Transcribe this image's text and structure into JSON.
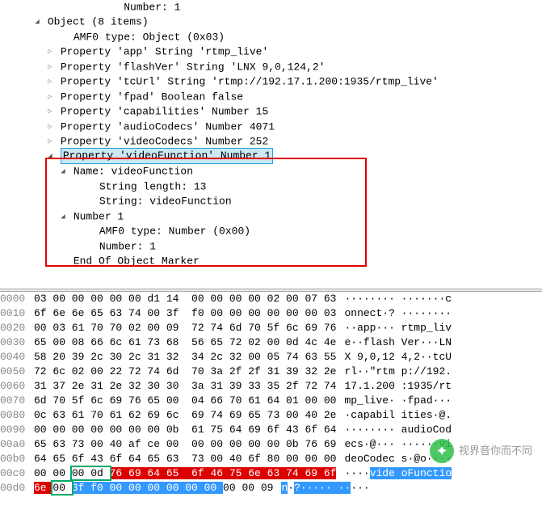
{
  "tree": {
    "n0": "        Number: 1",
    "n1": "Object (8 items)",
    "n2": "AMF0 type: Object (0x03)",
    "n3": "Property 'app' String 'rtmp_live'",
    "n4": "Property 'flashVer' String 'LNX 9,0,124,2'",
    "n5": "Property 'tcUrl' String 'rtmp://192.17.1.200:1935/rtmp_live'",
    "n6": "Property 'fpad' Boolean false",
    "n7": "Property 'capabilities' Number 15",
    "n8": "Property 'audioCodecs' Number 4071",
    "n9": "Property 'videoCodecs' Number 252",
    "n10": "Property 'videoFunction' Number 1",
    "n11": "Name: videoFunction",
    "n12": "String length: 13",
    "n13": "String: videoFunction",
    "n14": "Number 1",
    "n15": "AMF0 type: Number (0x00)",
    "n16": "Number: 1",
    "n17": "End Of Object Marker"
  },
  "hex": {
    "r0000": {
      "off": "0000",
      "b": "03 00 00 00 00 00 d1 14  00 00 00 00 02 00 07 63",
      "a": "········ ·······c"
    },
    "r0010": {
      "off": "0010",
      "b": "6f 6e 6e 65 63 74 00 3f  f0 00 00 00 00 00 00 03",
      "a": "onnect·? ········"
    },
    "r0020": {
      "off": "0020",
      "b": "00 03 61 70 70 02 00 09  72 74 6d 70 5f 6c 69 76",
      "a": "··app··· rtmp_liv"
    },
    "r0030": {
      "off": "0030",
      "b": "65 00 08 66 6c 61 73 68  56 65 72 02 00 0d 4c 4e",
      "a": "e··flash Ver···LN"
    },
    "r0040": {
      "off": "0040",
      "b": "58 20 39 2c 30 2c 31 32  34 2c 32 00 05 74 63 55",
      "a": "X 9,0,12 4,2··tcU"
    },
    "r0050": {
      "off": "0050",
      "b": "72 6c 02 00 22 72 74 6d  70 3a 2f 2f 31 39 32 2e",
      "a": "rl··\"rtm p://192."
    },
    "r0060": {
      "off": "0060",
      "b": "31 37 2e 31 2e 32 30 30  3a 31 39 33 35 2f 72 74",
      "a": "17.1.200 :1935/rt"
    },
    "r0070": {
      "off": "0070",
      "b": "6d 70 5f 6c 69 76 65 00  04 66 70 61 64 01 00 00",
      "a": "mp_live· ·fpad···"
    },
    "r0080": {
      "off": "0080",
      "b": "0c 63 61 70 61 62 69 6c  69 74 69 65 73 00 40 2e",
      "a": "·capabil ities·@."
    },
    "r0090": {
      "off": "0090",
      "b": "00 00 00 00 00 00 00 0b  61 75 64 69 6f 43 6f 64",
      "a": "········ audioCod"
    },
    "r00a0": {
      "off": "00a0",
      "b": "65 63 73 00 40 af ce 00  00 00 00 00 00 0b 76 69",
      "a": "ecs·@··· ······vi"
    },
    "r00b0": {
      "off": "00b0",
      "b": "64 65 6f 43 6f 64 65 63  73 00 40 6f 80 00 00 00",
      "a": "deoCodec s·@o····"
    },
    "r00c0": {
      "off": "00c0",
      "bpre": "00 00 ",
      "blen": "00 0d ",
      "bstr": "76 69 64 65  6f 46 75 6e 63 74 69 6f",
      "apre": "····",
      "asel": "vide oFunctio"
    },
    "r00d0": {
      "off": "00d0",
      "bstr": "6e ",
      "btype": "00 ",
      "bnum": "3f f0 00 00 00 00 00 00 ",
      "btail": "00 00 09",
      "asel": "n",
      "atype": "·",
      "anum": "?····· ··",
      "atail": "···"
    }
  },
  "watermark": {
    "text": "视界音你而不同"
  }
}
